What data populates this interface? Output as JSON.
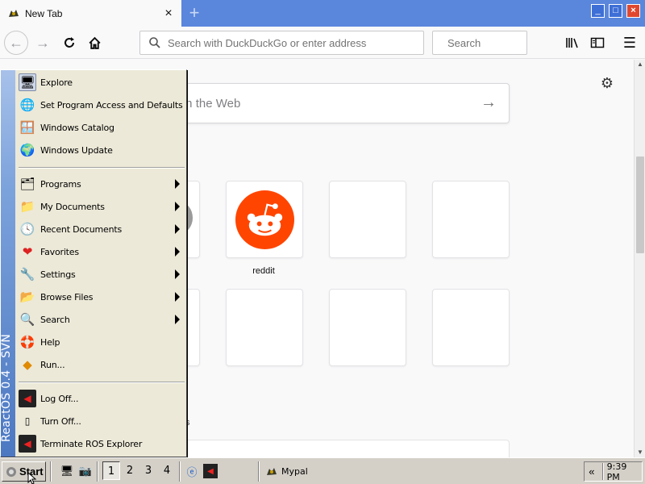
{
  "browser": {
    "tab_title": "New Tab",
    "new_tab_symbol": "+",
    "window_buttons": {
      "minimize": "_",
      "maximize": "□",
      "close": "×"
    },
    "close_tab_symbol": "×",
    "url_placeholder": "Search with DuckDuckGo or enter address",
    "search_placeholder": "Search"
  },
  "newtab": {
    "websearch_placeholder": "Search the Web",
    "top_sites": [
      {
        "label": ""
      },
      {
        "label": "reddit"
      },
      {
        "label": ""
      },
      {
        "label": ""
      },
      {
        "label": ""
      },
      {
        "label": ""
      },
      {
        "label": ""
      },
      {
        "label": ""
      }
    ],
    "section_tail_text": "s"
  },
  "start_menu": {
    "banner": "ReactOS 0.4 - SVN",
    "items": [
      {
        "label": "Explore",
        "icon": "explore-icon"
      },
      {
        "label": "Set Program Access and Defaults",
        "icon": "program-access-icon"
      },
      {
        "label": "Windows Catalog",
        "icon": "windows-catalog-icon"
      },
      {
        "label": "Windows Update",
        "icon": "windows-update-icon"
      },
      {
        "label": "Programs",
        "icon": "programs-icon",
        "submenu": true
      },
      {
        "label": "My Documents",
        "icon": "folder-icon",
        "submenu": true
      },
      {
        "label": "Recent Documents",
        "icon": "recent-documents-icon",
        "submenu": true
      },
      {
        "label": "Favorites",
        "icon": "heart-icon",
        "submenu": true
      },
      {
        "label": "Settings",
        "icon": "settings-icon",
        "submenu": true
      },
      {
        "label": "Browse Files",
        "icon": "folder-icon",
        "submenu": true
      },
      {
        "label": "Search",
        "icon": "search-icon",
        "submenu": true
      },
      {
        "label": "Help",
        "icon": "help-icon"
      },
      {
        "label": "Run...",
        "icon": "run-icon"
      },
      {
        "label": "Log Off...",
        "icon": "logoff-icon"
      },
      {
        "label": "Turn Off...",
        "icon": "power-icon"
      },
      {
        "label": "Terminate ROS Explorer",
        "icon": "terminate-icon"
      }
    ]
  },
  "taskbar": {
    "start_label": "Start",
    "desktops": [
      "1",
      "2",
      "3",
      "4"
    ],
    "active_desktop": "1",
    "task_label": "Mypal",
    "tray_chevron": "«",
    "clock": "9:39 PM"
  },
  "colors": {
    "titlebar": "#5a86dc",
    "reddit_orange": "#ff4500",
    "start_menu_bg": "#ece9d8",
    "taskbar_bg": "#d4d0c8"
  }
}
